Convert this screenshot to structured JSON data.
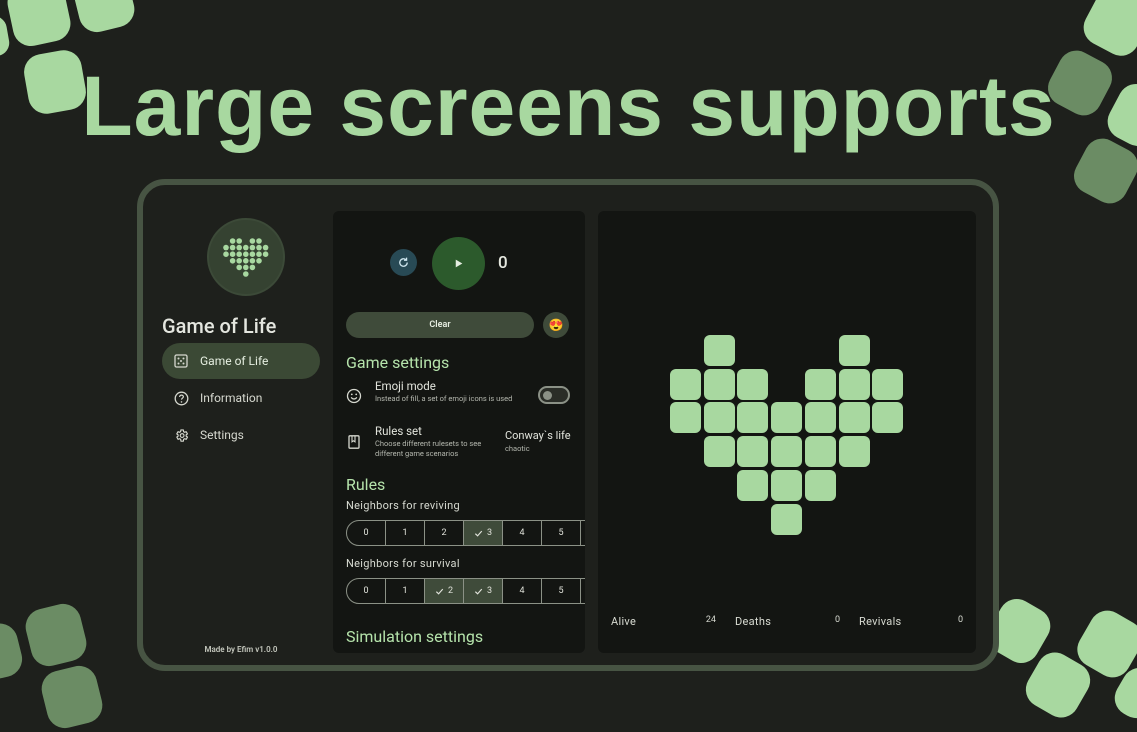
{
  "hero_title": "Large screens supports",
  "app": {
    "title": "Game of Life",
    "footer": "Made by Efim v1.0.0"
  },
  "nav": {
    "items": [
      {
        "label": "Game of Life",
        "icon": "dice-icon",
        "active": true
      },
      {
        "label": "Information",
        "icon": "help-circle-icon",
        "active": false
      },
      {
        "label": "Settings",
        "icon": "gear-icon",
        "active": false
      }
    ]
  },
  "controls": {
    "generation": "0",
    "clear_label": "Clear",
    "emoji_button": "😍"
  },
  "game_settings": {
    "title": "Game settings",
    "emoji_mode": {
      "title": "Emoji mode",
      "description": "Instead of fill, a set of emoji icons is used",
      "enabled": false
    },
    "rules_set": {
      "title": "Rules set",
      "description": "Choose different rulesets to see different game scenarios",
      "value": "Conway`s life",
      "sub": "chaotic"
    }
  },
  "rules": {
    "title": "Rules",
    "reviving": {
      "label": "Neighbors for reviving",
      "options": [
        "0",
        "1",
        "2",
        "3",
        "4",
        "5"
      ],
      "selected": [
        "3"
      ]
    },
    "survival": {
      "label": "Neighbors for survival",
      "options": [
        "0",
        "1",
        "2",
        "3",
        "4",
        "5"
      ],
      "selected": [
        "2",
        "3"
      ]
    }
  },
  "simulation_settings": {
    "title": "Simulation settings"
  },
  "stats": {
    "alive_label": "Alive",
    "alive": "24",
    "deaths_label": "Deaths",
    "deaths": "0",
    "revivals_label": "Revivals",
    "revivals": "0"
  },
  "colors": {
    "accent": "#a8d8a0",
    "background": "#1e201c",
    "panel": "#131512",
    "selected": "#3f4b3a"
  }
}
